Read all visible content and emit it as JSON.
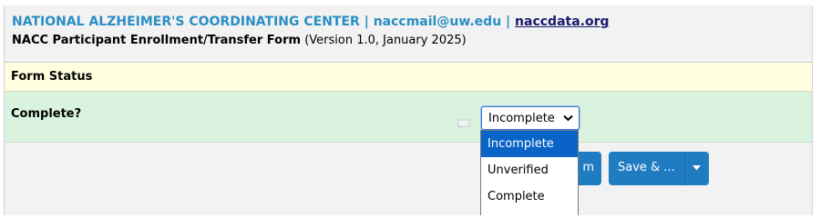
{
  "header": {
    "org_name": "NATIONAL ALZHEIMER'S COORDINATING CENTER",
    "separator": " | ",
    "email": "naccmail@uw.edu",
    "site": "naccdata.org",
    "form_name": "NACC Participant Enrollment/Transfer Form",
    "form_version": " (Version 1.0, January 2025)"
  },
  "section": {
    "title": "Form Status"
  },
  "complete_field": {
    "label": "Complete?",
    "selected": "Incomplete",
    "options": [
      "Incomplete",
      "Unverified",
      "Complete"
    ],
    "highlighted_option": "Incomplete"
  },
  "actions": {
    "save_form_partial": "m",
    "save_and_label": "Save & ..."
  },
  "colors": {
    "header_text": "#2a8ec4",
    "section_bg": "#ffffe0",
    "field_bg": "#d9f3de",
    "button_bg": "#1f7cc1",
    "option_highlight": "#0a64c8"
  }
}
